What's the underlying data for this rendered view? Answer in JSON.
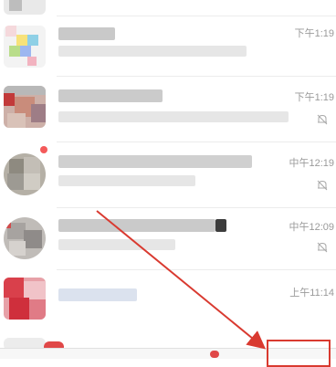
{
  "chats": [
    {
      "time": "",
      "muted": false
    },
    {
      "time": "下午1:19",
      "muted": false
    },
    {
      "time": "下午1:19",
      "muted": true
    },
    {
      "time": "中午12:19",
      "muted": true
    },
    {
      "time": "中午12:09",
      "muted": true
    },
    {
      "time": "上午11:14",
      "muted": false
    }
  ],
  "colors": {
    "accent_red": "#d93a30",
    "time_text": "#9a9a9a",
    "divider": "#ececec"
  },
  "icons": [
    "mute-bell-icon",
    "annotation-arrow",
    "highlight-box"
  ]
}
